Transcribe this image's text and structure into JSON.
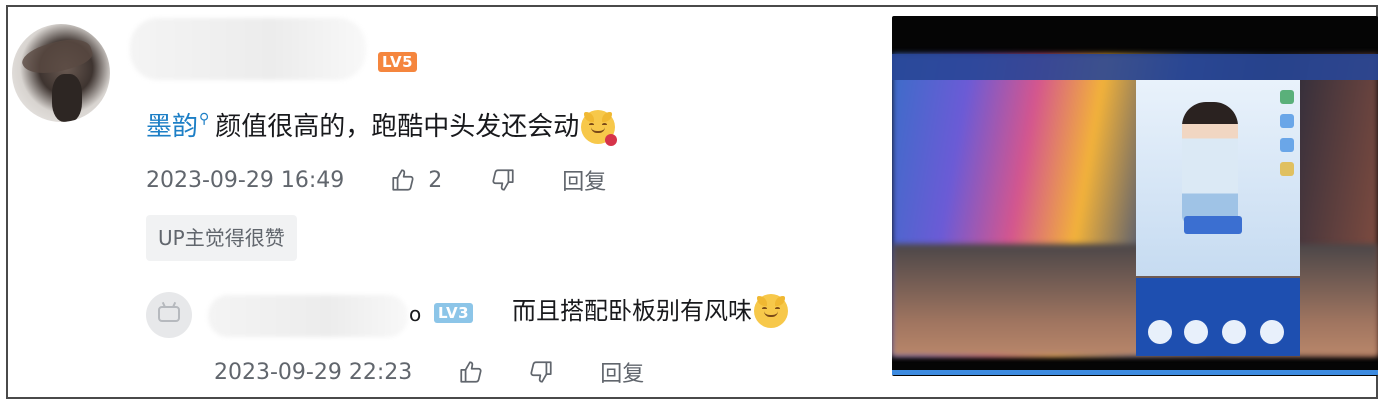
{
  "comment": {
    "level_badge": "LV5",
    "mention": "墨韵",
    "text": "颜值很高的，跑酷中头发还会动",
    "emoji_icon": "smiling-cat-emoji-icon",
    "timestamp": "2023-09-29 16:49",
    "like_count": "2",
    "reply_label": "回复",
    "up_tag": "UP主觉得很赞"
  },
  "reply": {
    "name_suffix": "o",
    "level_badge": "LV3",
    "text": "而且搭配卧板别有风味",
    "emoji_icon": "smiling-cat-emoji-icon",
    "timestamp": "2023-09-29 22:23",
    "reply_label": "回复"
  },
  "colors": {
    "mention": "#1d7fc6",
    "lv5": "#f5863e",
    "lv3": "#8cc5e8",
    "meta_text": "#61666d"
  }
}
